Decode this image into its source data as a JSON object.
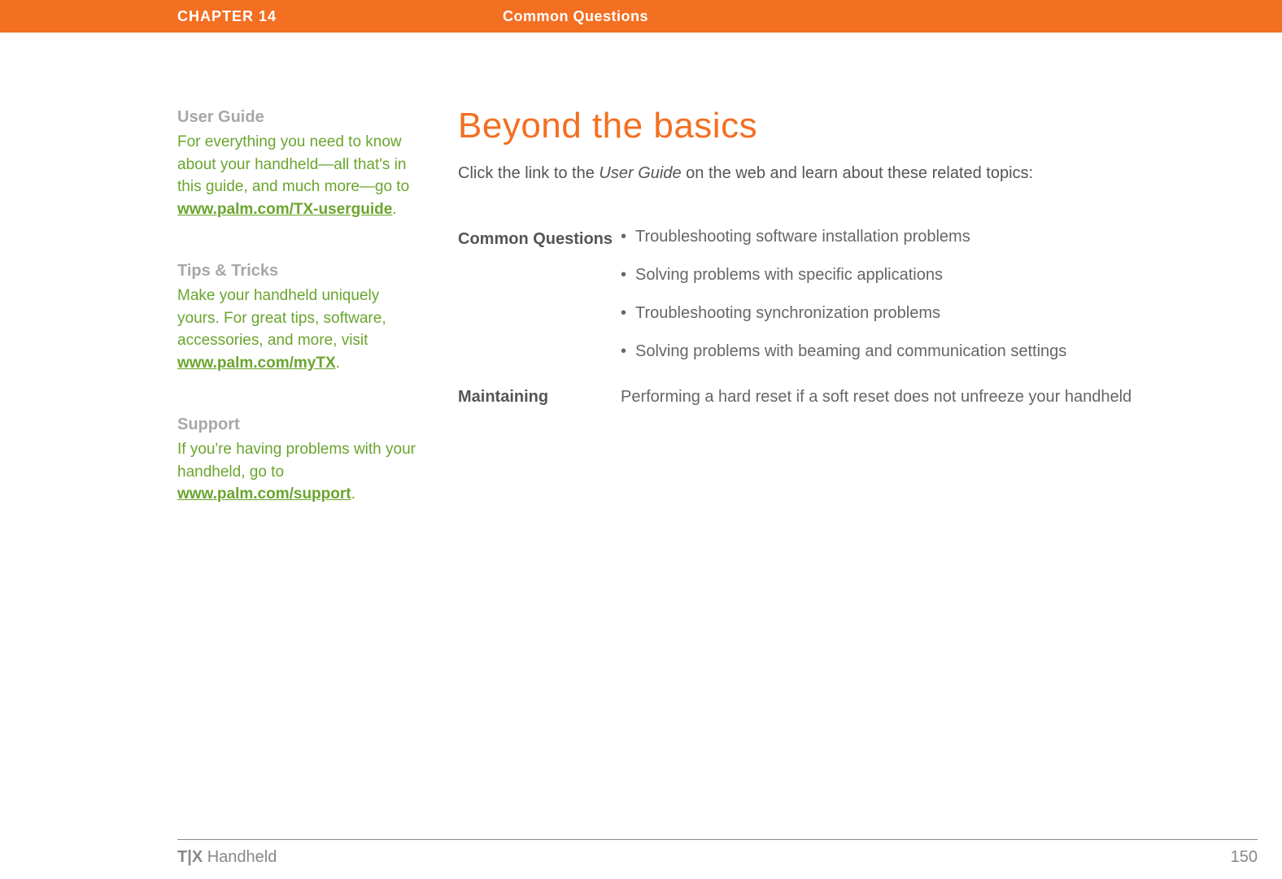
{
  "header": {
    "chapter": "CHAPTER 14",
    "section": "Common Questions"
  },
  "sidebar": {
    "user_guide": {
      "heading": "User Guide",
      "text_before": "For everything you need to know about your handheld—all that's in this guide, and much more—go to ",
      "link": "www.palm.com/TX-userguide",
      "text_after": "."
    },
    "tips": {
      "heading": "Tips & Tricks",
      "text_before": "Make your handheld uniquely yours. For great tips, software, accessories, and more, visit ",
      "link": "www.palm.com/myTX",
      "text_after": "."
    },
    "support": {
      "heading": "Support",
      "text_before": "If you're having problems with your handheld, go to ",
      "link": "www.palm.com/support",
      "text_after": "."
    }
  },
  "main": {
    "title": "Beyond the basics",
    "intro_before": "Click the link to the ",
    "intro_italic": "User Guide",
    "intro_after": " on the web and learn about these related topics:",
    "topics": [
      {
        "label": "Common Questions",
        "bullets": [
          "Troubleshooting software installation problems",
          "Solving problems with specific applications",
          "Troubleshooting synchronization problems",
          "Solving problems with beaming and communication settings"
        ]
      },
      {
        "label": "Maintaining",
        "plain": "Performing a hard reset if a soft reset does not unfreeze your handheld"
      }
    ]
  },
  "footer": {
    "product_bold": "T|X",
    "product_rest": " Handheld",
    "page": "150"
  }
}
